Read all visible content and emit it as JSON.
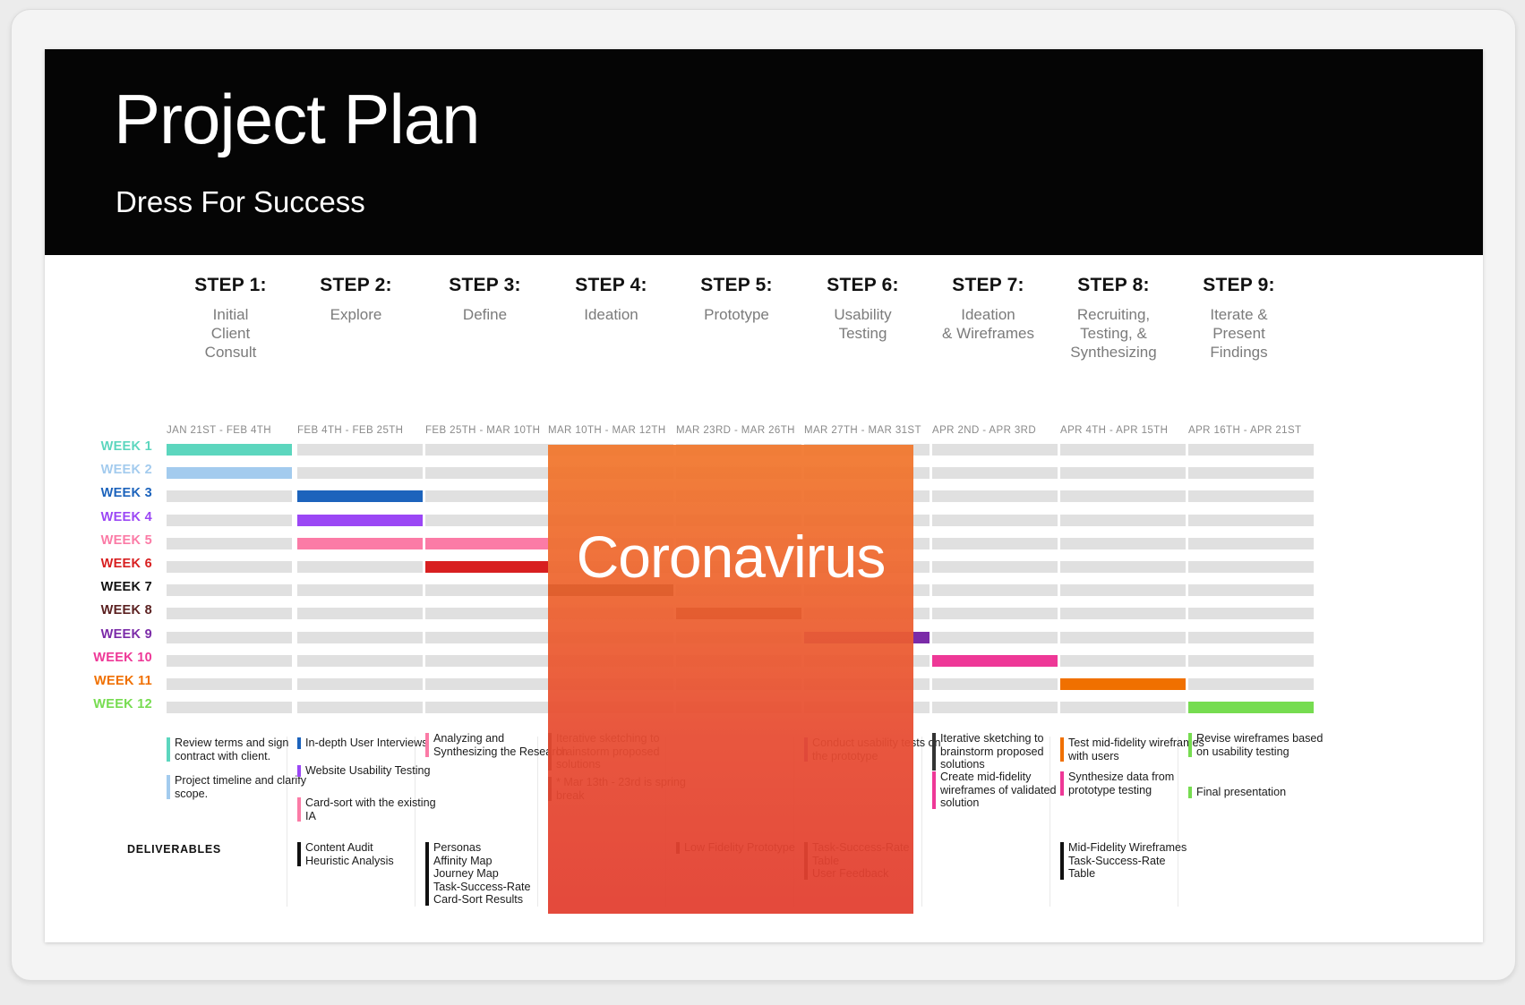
{
  "slide": {
    "title": "Project Plan",
    "subtitle": "Dress For Success",
    "deliverables_label": "DELIVERABLES",
    "overlay_text": "Coronavirus",
    "overlay_color": "#E8522F"
  },
  "steps": [
    {
      "num": "STEP 1:",
      "name": "Initial\nClient\nConsult",
      "dates": "JAN 21ST - FEB 4TH"
    },
    {
      "num": "STEP 2:",
      "name": "Explore",
      "dates": "FEB 4TH - FEB 25TH"
    },
    {
      "num": "STEP 3:",
      "name": "Define",
      "dates": "FEB 25TH - MAR 10TH"
    },
    {
      "num": "STEP 4:",
      "name": "Ideation",
      "dates": "MAR 10TH - MAR 12TH"
    },
    {
      "num": "STEP 5:",
      "name": "Prototype",
      "dates": "MAR 23RD - MAR 26TH"
    },
    {
      "num": "STEP 6:",
      "name": "Usability\nTesting",
      "dates": "MAR 27TH - MAR 31ST"
    },
    {
      "num": "STEP 7:",
      "name": "Ideation\n& Wireframes",
      "dates": "APR 2ND - APR 3RD"
    },
    {
      "num": "STEP 8:",
      "name": "Recruiting,\nTesting, &\nSynthesizing",
      "dates": "APR 4TH - APR 15TH"
    },
    {
      "num": "STEP 9:",
      "name": "Iterate &\nPresent\nFindings",
      "dates": "APR 16TH - APR 21ST"
    }
  ],
  "weeks": [
    {
      "label": "WEEK 1",
      "color": "#5CD6BE"
    },
    {
      "label": "WEEK 2",
      "color": "#A3CBEE"
    },
    {
      "label": "WEEK 3",
      "color": "#1C63BC"
    },
    {
      "label": "WEEK 4",
      "color": "#9B47F5"
    },
    {
      "label": "WEEK 5",
      "color": "#FB7BA6"
    },
    {
      "label": "WEEK 6",
      "color": "#D81F20"
    },
    {
      "label": "WEEK 7",
      "color": "#111111"
    },
    {
      "label": "WEEK 8",
      "color": "#5B2121"
    },
    {
      "label": "WEEK 9",
      "color": "#7B2BA8"
    },
    {
      "label": "WEEK 10",
      "color": "#EE3897"
    },
    {
      "label": "WEEK 11",
      "color": "#F07000"
    },
    {
      "label": "WEEK 12",
      "color": "#76DC50"
    }
  ],
  "timeline": {
    "empty_bar_color": "#E0E0E0",
    "filled": [
      {
        "week": 1,
        "step": 1,
        "color": "#5CD6BE"
      },
      {
        "week": 2,
        "step": 1,
        "color": "#A3CBEE"
      },
      {
        "week": 3,
        "step": 2,
        "color": "#1C63BC"
      },
      {
        "week": 4,
        "step": 2,
        "color": "#9B47F5"
      },
      {
        "week": 5,
        "step": 2,
        "color": "#FB7BA6"
      },
      {
        "week": 5,
        "step": 3,
        "color": "#FB7BA6"
      },
      {
        "week": 6,
        "step": 3,
        "color": "#D81F20"
      },
      {
        "week": 7,
        "step": 4,
        "color": "#111111"
      },
      {
        "week": 8,
        "step": 5,
        "color": "#5B2121"
      },
      {
        "week": 9,
        "step": 6,
        "color": "#7B2BA8"
      },
      {
        "week": 10,
        "step": 7,
        "color": "#EE3897"
      },
      {
        "week": 11,
        "step": 8,
        "color": "#F07000"
      },
      {
        "week": 12,
        "step": 9,
        "color": "#76DC50"
      }
    ]
  },
  "notes": {
    "step1": [
      {
        "text": "Review terms and sign contract with client.",
        "color": "#5CD6BE"
      },
      {
        "text": "Project timeline and clarify scope.",
        "color": "#A3CBEE"
      }
    ],
    "step2": [
      {
        "text": "In-depth User Interviews",
        "color": "#1C63BC"
      },
      {
        "text": "Website Usability Testing",
        "color": "#9B47F5"
      },
      {
        "text": "Card-sort with the existing IA",
        "color": "#FB7BA6"
      }
    ],
    "step3": [
      {
        "text": "Analyzing and Synthesizing the Research",
        "color": "#FB7BA6"
      }
    ],
    "step4": [
      {
        "text": "Iterative sketching to brainstorm proposed solutions",
        "color": "#111111"
      },
      {
        "text": "* Mar 13th - 23rd is spring break",
        "color": "#111111"
      }
    ],
    "step6": [
      {
        "text": "Conduct usability tests on the prototype",
        "color": "#7B2BA8"
      }
    ],
    "step7": [
      {
        "text": "Iterative sketching to brainstorm proposed solutions",
        "color": "#333333"
      },
      {
        "text": "Create mid-fidelity wireframes of validated solution",
        "color": "#EE3897"
      }
    ],
    "step8": [
      {
        "text": "Test mid-fidelity wireframes with users",
        "color": "#F07000"
      },
      {
        "text": "Synthesize data from prototype testing",
        "color": "#EE3897"
      }
    ],
    "step9": [
      {
        "text": "Revise wireframes based on usability testing",
        "color": "#76DC50"
      },
      {
        "text": "Final presentation",
        "color": "#76DC50"
      }
    ]
  },
  "deliverables": {
    "step2": {
      "text": "Content Audit\nHeuristic Analysis",
      "color": "#111111"
    },
    "step3": {
      "text": "Personas\nAffinity Map\nJourney Map\nTask-Success-Rate\nCard-Sort Results",
      "color": "#111111"
    },
    "step5": {
      "text": "Low Fidelity Prototype",
      "color": "#111111"
    },
    "step6": {
      "text": "Task-Success-Rate\nTable\nUser Feedback",
      "color": "#111111"
    },
    "step8": {
      "text": "Mid-Fidelity Wireframes\nTask-Success-Rate\nTable",
      "color": "#111111"
    }
  }
}
